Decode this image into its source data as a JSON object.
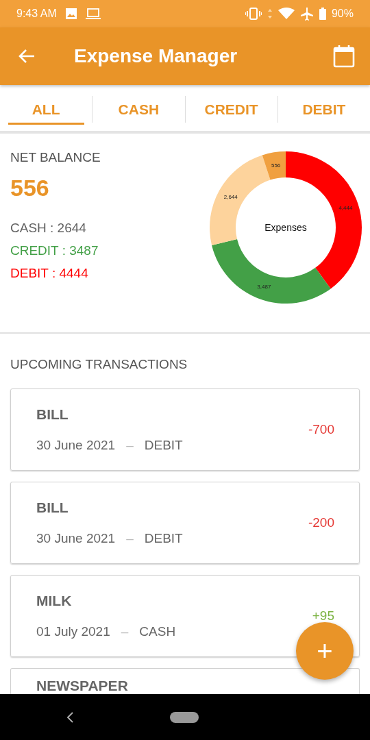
{
  "status_bar": {
    "time": "9:43 AM",
    "battery": "90%"
  },
  "app_bar": {
    "title": "Expense Manager"
  },
  "tabs": [
    {
      "label": "ALL",
      "selected": true
    },
    {
      "label": "CASH",
      "selected": false
    },
    {
      "label": "CREDIT",
      "selected": false
    },
    {
      "label": "DEBIT",
      "selected": false
    }
  ],
  "summary": {
    "heading": "NET BALANCE",
    "balance": "556",
    "lines": [
      {
        "text": "CASH : 2644",
        "color": "#616161"
      },
      {
        "text": "CREDIT : 3487",
        "color": "#43a047"
      },
      {
        "text": "DEBIT : 4444",
        "color": "#ff0000"
      }
    ],
    "chart_data": {
      "type": "donut",
      "title": "Expenses",
      "values": [
        4444,
        3487,
        2644,
        556
      ],
      "colors": [
        "#ff0000",
        "#43a047",
        "#fdd39c",
        "#f0a040"
      ],
      "data_labels": true,
      "value_labels": [
        "4,444",
        "3,487",
        "2,644",
        "556"
      ]
    }
  },
  "upcoming": {
    "heading": "UPCOMING TRANSACTIONS",
    "transactions": [
      {
        "title": "BILL",
        "date": "30 June 2021",
        "separator": "–",
        "type": "DEBIT",
        "amount": "-700",
        "kind": "expense"
      },
      {
        "title": "BILL",
        "date": "30 June 2021",
        "separator": "–",
        "type": "DEBIT",
        "amount": "-200",
        "kind": "expense"
      },
      {
        "title": "MILK",
        "date": "01 July 2021",
        "separator": "–",
        "type": "CASH",
        "amount": "+95",
        "kind": "income"
      },
      {
        "title": "NEWSPAPER"
      }
    ]
  },
  "fab": {
    "label": "+"
  }
}
